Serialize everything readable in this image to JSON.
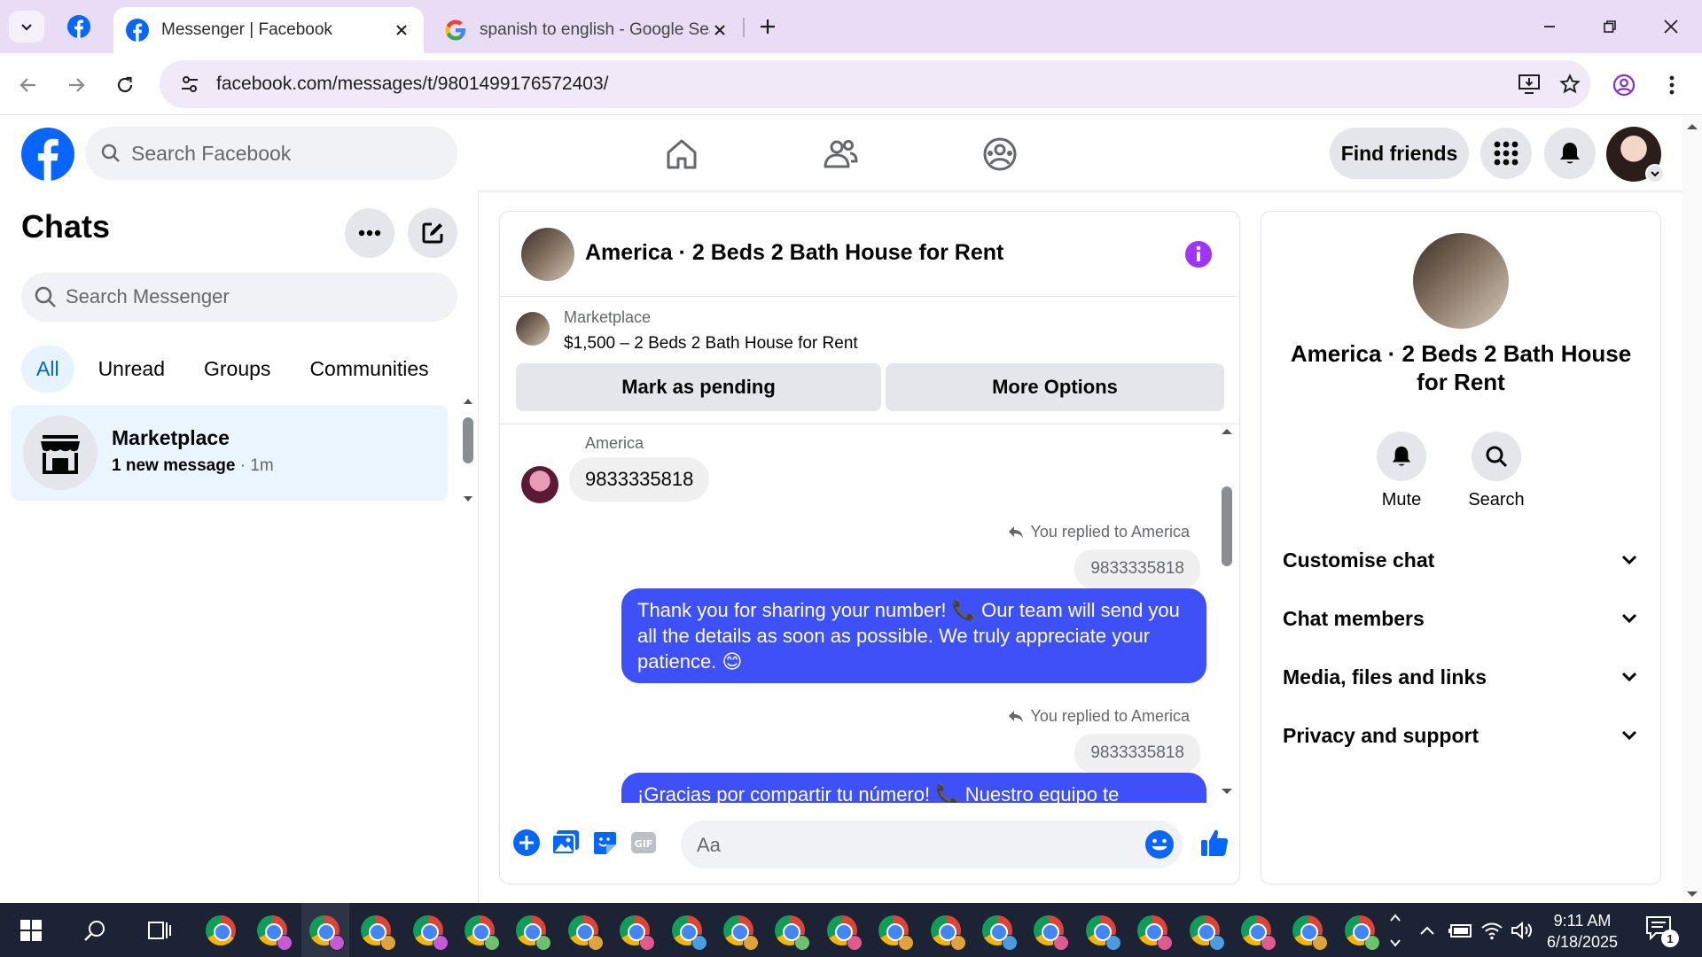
{
  "browser": {
    "tabs": [
      {
        "title": "Messenger | Facebook",
        "active": true
      },
      {
        "title": "spanish to english - Google Sea",
        "active": false
      }
    ],
    "url": "facebook.com/messages/t/9801499176572403/"
  },
  "fb_header": {
    "search_placeholder": "Search Facebook",
    "find_friends_label": "Find friends"
  },
  "sidebar": {
    "title": "Chats",
    "search_placeholder": "Search Messenger",
    "filters": [
      "All",
      "Unread",
      "Groups",
      "Communities"
    ],
    "active_filter": "All",
    "chats": [
      {
        "name": "Marketplace",
        "preview": "1 new message",
        "time": " · 1m"
      }
    ]
  },
  "conversation": {
    "title": "America · 2 Beds 2 Bath House for Rent",
    "marketplace_label": "Marketplace",
    "listing": "$1,500 – 2 Beds 2 Bath House for Rent",
    "buttons": {
      "pending": "Mark as pending",
      "more": "More Options"
    },
    "messages": {
      "sender": "America",
      "incoming": "9833335818",
      "replied_label_1": "You replied to America",
      "quote_1": "9833335818",
      "outgoing_1": "Thank you for sharing your number! 📞 Our team will send you all the details as soon as possible. We truly appreciate your patience. 😊",
      "replied_label_2": "You replied to America",
      "quote_2": "9833335818",
      "outgoing_2": "¡Gracias por compartir tu número! 📞 Nuestro equipo te"
    },
    "composer_placeholder": "Aa"
  },
  "info_panel": {
    "title": "America · 2 Beds 2 Bath House for Rent",
    "actions": {
      "mute": "Mute",
      "search": "Search"
    },
    "sections": [
      "Customise chat",
      "Chat members",
      "Media, files and links",
      "Privacy and support"
    ]
  },
  "taskbar": {
    "time": "9:11 AM",
    "date": "6/18/2025",
    "notification_count": "1"
  },
  "colors": {
    "fb_blue": "#0866ff",
    "bubble_out": "#3e50f7",
    "info_purple": "#a033ff",
    "tabbar_bg": "#e9ddf5"
  }
}
